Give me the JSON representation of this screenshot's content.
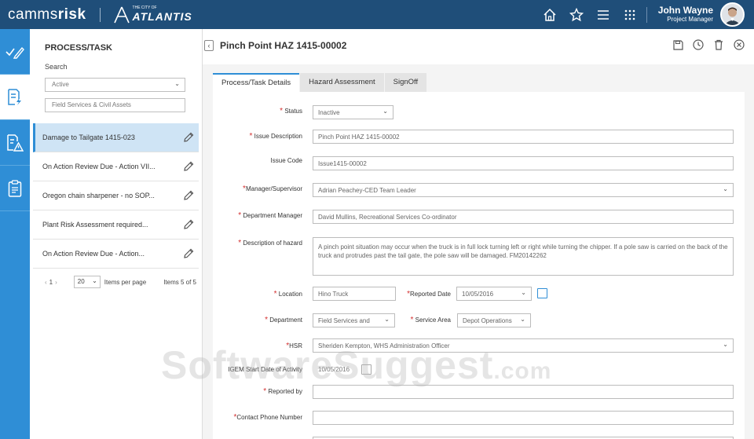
{
  "header": {
    "brand_part1": "camms",
    "brand_part2": "risk",
    "org_small": "THE CITY OF",
    "org_name": "ATLANTIS",
    "icons": [
      "home-icon",
      "star-icon",
      "menu-icon",
      "apps-grid-icon"
    ],
    "user_name": "John Wayne",
    "user_role": "Project Manager"
  },
  "rail": {
    "items": [
      "tasks-icon",
      "document-bolt-icon",
      "hazard-report-icon",
      "clipboard-icon"
    ]
  },
  "side_panel": {
    "title": "PROCESS/TASK",
    "search_label": "Search",
    "status_filter": "Active",
    "search_placeholder": "Field Services & Civil Assets",
    "items": [
      {
        "label": "Damage to Tailgate 1415-023"
      },
      {
        "label": "On Action Review Due - Action VII..."
      },
      {
        "label": "Oregon chain sharpener - no SOP..."
      },
      {
        "label": "Plant Risk Assessment required..."
      },
      {
        "label": "On Action Review Due - Action..."
      }
    ],
    "pager": {
      "prev": "‹",
      "page": "1",
      "next": "›",
      "page_size": "20",
      "items_per_page_label": "Items per page",
      "items_count": "Items 5 of 5"
    }
  },
  "main": {
    "back_label": "‹",
    "title": "Pinch Point HAZ 1415-00002",
    "head_icons": [
      "save-icon",
      "history-icon",
      "trash-icon",
      "close-icon"
    ],
    "tabs": [
      {
        "label": "Process/Task Details"
      },
      {
        "label": "Hazard Assessment"
      },
      {
        "label": "SignOff"
      }
    ],
    "form": {
      "status": {
        "label": "Status",
        "value": "Inactive"
      },
      "issue_description": {
        "label": "Issue Description",
        "value": "Pinch Point HAZ 1415-00002"
      },
      "issue_code": {
        "label": "Issue Code",
        "value": "Issue1415-00002"
      },
      "manager": {
        "label": "Manager/Supervisor",
        "value": "Adrian Peachey-CED Team Leader"
      },
      "department_manager": {
        "label": "Department Manager",
        "value": "David Mullins, Recreational Services Co-ordinator"
      },
      "description": {
        "label": "Description of hazard",
        "value": "A pinch point situation may occur when the truck is in full lock turning left or right while turning the chipper. If a pole saw is carried on the back of the truck and protrudes past the tail gate, the pole saw will be damaged. FM20142262"
      },
      "location": {
        "label": "Location",
        "value": "Hino Truck"
      },
      "reported_date": {
        "label": "Reported Date",
        "value": "10/05/2016"
      },
      "department": {
        "label": "Department",
        "value": "Field Services and"
      },
      "service_area": {
        "label": "Service Area",
        "value": "Depot Operations"
      },
      "hsr": {
        "label": "HSR",
        "value": "Sheriden Kempton, WHS Administration Officer"
      },
      "igem_start": {
        "label": "IGEM Start Date of Activity",
        "value": "10/05/2016"
      },
      "reported_by": {
        "label": "Reported by",
        "value": ""
      },
      "contact_phone": {
        "label": "Contact Phone Number",
        "value": ""
      }
    }
  },
  "watermark": {
    "text": "SoftwareSuggest",
    "suffix": ".com"
  },
  "colors": {
    "topbar": "#1f4e79",
    "rail": "#2f8ed6",
    "active_item": "#cfe4f5",
    "required": "#d32f2f"
  }
}
